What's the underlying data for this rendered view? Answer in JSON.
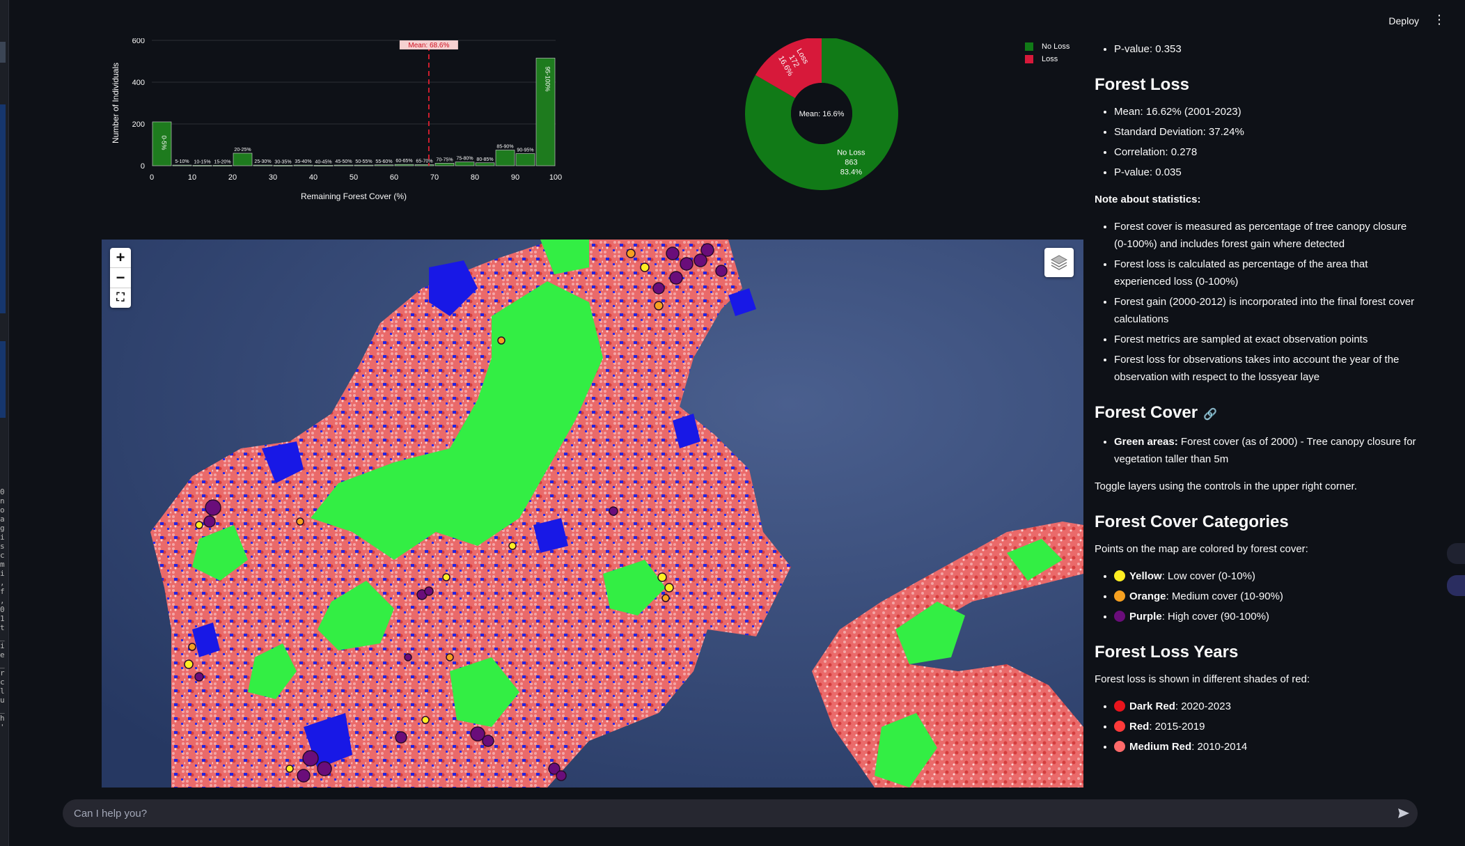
{
  "topbar": {
    "deploy_label": "Deploy",
    "menu_icon": "kebab-menu-icon"
  },
  "chart_data": [
    {
      "type": "bar",
      "xlabel": "Remaining Forest Cover (%)",
      "ylabel": "Number of Individuals",
      "ylim": [
        0,
        600
      ],
      "xlim": [
        0,
        100
      ],
      "xticks": [
        "0",
        "10",
        "20",
        "30",
        "40",
        "50",
        "60",
        "70",
        "80",
        "90",
        "100"
      ],
      "yticks": [
        "0",
        "200",
        "400",
        "600"
      ],
      "categories": [
        "0-5%",
        "5-10%",
        "10-15%",
        "15-20%",
        "20-25%",
        "25-30%",
        "30-35%",
        "35-40%",
        "40-45%",
        "45-50%",
        "50-55%",
        "55-60%",
        "60-65%",
        "65-70%",
        "70-75%",
        "75-80%",
        "80-85%",
        "85-90%",
        "90-95%",
        "95-100%"
      ],
      "values": [
        210,
        3,
        2,
        2,
        60,
        3,
        2,
        3,
        2,
        3,
        3,
        4,
        6,
        5,
        12,
        18,
        14,
        75,
        58,
        515
      ],
      "mean_line": {
        "x": 68.6,
        "label": "Mean: 68.6%"
      },
      "color": "#1e7b1e"
    },
    {
      "type": "pie",
      "labels": [
        "No Loss",
        "Loss"
      ],
      "values": [
        863,
        172
      ],
      "percentages": [
        "83.4%",
        "16.6%"
      ],
      "colors": [
        "#117a17",
        "#d7193a"
      ],
      "center_label": "Mean: 16.6%",
      "legend": [
        "No Loss",
        "Loss"
      ],
      "legend_position": "top-right"
    }
  ],
  "side": {
    "top_bullets": [
      "P-value: 0.353"
    ],
    "forest_loss": {
      "heading": "Forest Loss",
      "bullets": [
        "Mean: 16.62% (2001-2023)",
        "Standard Deviation: 37.24%",
        "Correlation: 0.278",
        "P-value: 0.035"
      ]
    },
    "note_heading": "Note about statistics:",
    "notes": [
      "Forest cover is measured as percentage of tree canopy closure (0-100%) and includes forest gain where detected",
      "Forest loss is calculated as percentage of the area that experienced loss (0-100%)",
      "Forest gain (2000-2012) is incorporated into the final forest cover calculations",
      "Forest metrics are sampled at exact observation points",
      "Forest loss for observations takes into account the year of the observation with respect to the lossyear laye"
    ],
    "forest_cover": {
      "heading": "Forest Cover",
      "bullet_bold": "Green areas:",
      "bullet_text": " Forest cover (as of 2000) - Tree canopy closure for vegetation taller than 5m",
      "toggle_text": "Toggle layers using the controls in the upper right corner."
    },
    "categories": {
      "heading": "Forest Cover Categories",
      "intro": "Points on the map are colored by forest cover:",
      "items": [
        {
          "bold": "Yellow",
          "text": ": Low cover (0-10%)",
          "color": "#ffee22"
        },
        {
          "bold": "Orange",
          "text": ": Medium cover (10-90%)",
          "color": "#f5a020"
        },
        {
          "bold": "Purple",
          "text": ": High cover (90-100%)",
          "color": "#6a0d7a"
        }
      ]
    },
    "loss_years": {
      "heading": "Forest Loss Years",
      "intro": "Forest loss is shown in different shades of red:",
      "items": [
        {
          "bold": "Dark Red",
          "text": ": 2020-2023",
          "color": "#e8141c"
        },
        {
          "bold": "Red",
          "text": ": 2015-2019",
          "color": "#ff3a3a"
        },
        {
          "bold": "Medium Red",
          "text": ": 2010-2014",
          "color": "#ff6a6a"
        }
      ]
    }
  },
  "map": {
    "zoom_in": "+",
    "zoom_out": "−"
  },
  "chat": {
    "placeholder": "Can I help you?"
  }
}
